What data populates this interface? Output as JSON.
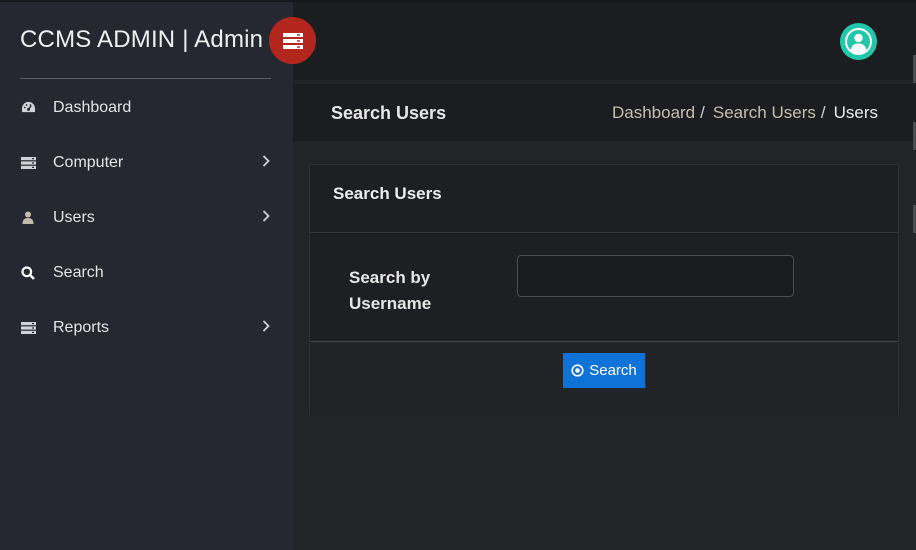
{
  "brand": {
    "title": "CCMS ADMIN | Admin",
    "menu_toggle_icon": "server-icon"
  },
  "sidebar": {
    "items": [
      {
        "label": "Dashboard",
        "icon": "dashboard-gauge-icon",
        "has_submenu": false
      },
      {
        "label": "Computer",
        "icon": "server-icon",
        "has_submenu": true
      },
      {
        "label": "Users",
        "icon": "user-icon",
        "has_submenu": true
      },
      {
        "label": "Search",
        "icon": "search-icon",
        "has_submenu": false
      },
      {
        "label": "Reports",
        "icon": "server-icon",
        "has_submenu": true
      }
    ]
  },
  "topbar": {
    "avatar_icon": "user-avatar-icon"
  },
  "page_header": {
    "title": "Search Users",
    "breadcrumb": {
      "items": [
        "Dashboard",
        "Search Users"
      ],
      "active": "Users"
    }
  },
  "card": {
    "title": "Search Users",
    "field_label": "Search by Username",
    "input": {
      "value": "",
      "placeholder": ""
    },
    "button_label": "Search",
    "button_icon": "dot-circle-icon"
  },
  "colors": {
    "sidebar_bg": "#252830",
    "main_bg": "#222427",
    "accent_red": "#b3261e",
    "avatar_teal": "#21c7a8",
    "primary_button": "#0f72d6"
  }
}
